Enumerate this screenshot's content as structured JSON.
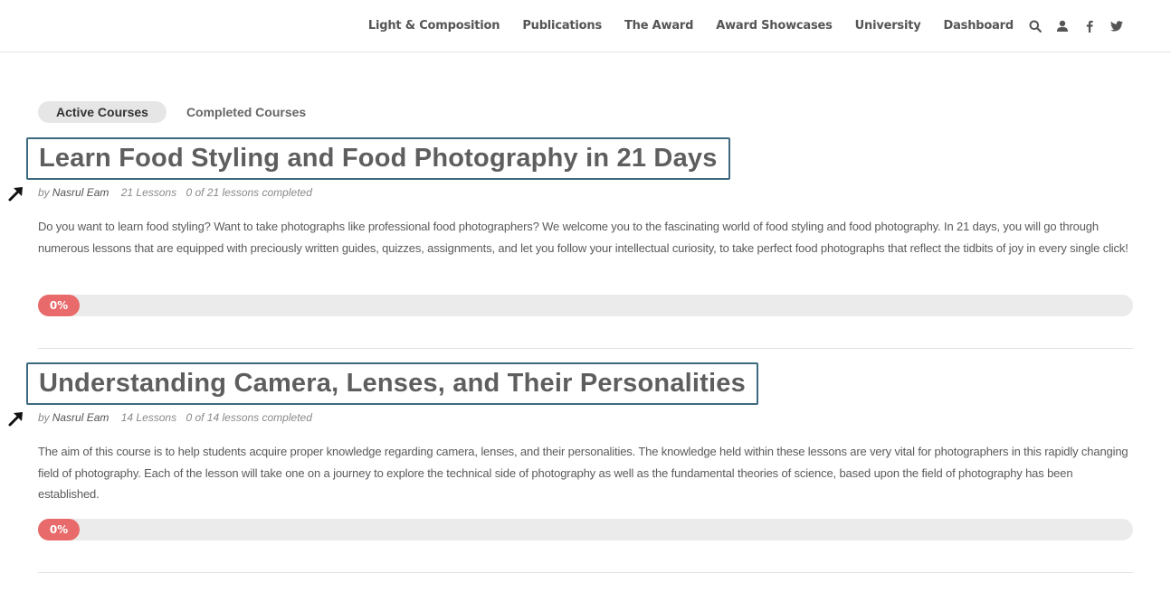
{
  "header": {
    "nav": [
      {
        "label": "Light & Composition"
      },
      {
        "label": "Publications"
      },
      {
        "label": "The Award"
      },
      {
        "label": "Award Showcases"
      },
      {
        "label": "University"
      },
      {
        "label": "Dashboard"
      }
    ],
    "icons": [
      "search-icon",
      "user-icon",
      "facebook-icon",
      "twitter-icon"
    ]
  },
  "tabs": [
    {
      "label": "Active Courses",
      "active": true
    },
    {
      "label": "Completed Courses",
      "active": false
    }
  ],
  "courses": [
    {
      "title": "Learn Food Styling and Food Photography in 21 Days",
      "by": "by",
      "author": "Nasrul Eam",
      "lessons": "21 Lessons",
      "completed": "0 of 21 lessons completed",
      "description": "Do you want to learn food styling? Want to take photographs like professional food photographers? We welcome you to the fascinating world of food styling and food photography. In 21 days, you will go through numerous lessons that are equipped with preciously written guides, quizzes, assignments, and let you follow your intellectual curiosity, to take perfect food photographs that reflect the tidbits of joy in every single click!",
      "progress_percent": 0,
      "progress_label": "0%"
    },
    {
      "title": "Understanding Camera, Lenses, and Their Personalities",
      "by": "by",
      "author": "Nasrul Eam",
      "lessons": "14 Lessons",
      "completed": "0 of 14 lessons completed",
      "description": "The aim of this course is to help students acquire proper knowledge regarding camera, lenses, and their personalities. The knowledge held within these lessons are very vital for photographers in this rapidly changing field of photography. Each of the lesson will take one on a journey to explore the technical side of photography as well as the fundamental theories of science, based upon the field of photography has been established.",
      "progress_percent": 0,
      "progress_label": "0%"
    }
  ],
  "colors": {
    "title_border": "#3e6a80",
    "progress_fill": "#e86a6a",
    "progress_track": "#ebebeb",
    "active_tab_bg": "#e6e6e6"
  }
}
